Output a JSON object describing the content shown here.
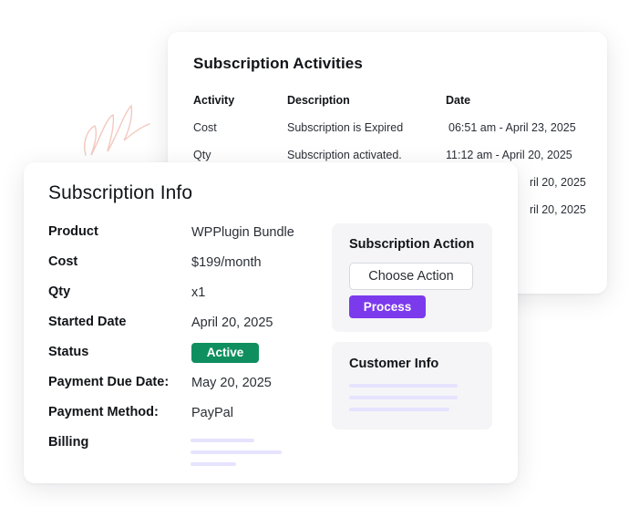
{
  "activities": {
    "title": "Subscription Activities",
    "columns": [
      "Activity",
      "Description",
      "Date"
    ],
    "rows": [
      {
        "activity": "Cost",
        "description": "Subscription is Expired",
        "date": "06:51 am - April 23, 2025"
      },
      {
        "activity": "Qty",
        "description": "Subscription activated.",
        "date": "11:12 am - April 20, 2025"
      },
      {
        "activity": "",
        "description": "",
        "date": "ril 20, 2025"
      },
      {
        "activity": "",
        "description": "",
        "date": "ril 20, 2025"
      }
    ]
  },
  "info": {
    "title": "Subscription Info",
    "fields": [
      {
        "label": "Product",
        "value": "WPPlugin Bundle"
      },
      {
        "label": "Cost",
        "value": "$199/month"
      },
      {
        "label": "Qty",
        "value": "x1"
      },
      {
        "label": "Started Date",
        "value": "April 20, 2025"
      },
      {
        "label": "Status",
        "value": "Active"
      },
      {
        "label": "Payment Due Date:",
        "value": "May 20, 2025"
      },
      {
        "label": "Payment Method:",
        "value": "PayPal"
      },
      {
        "label": "Billing",
        "value": ""
      }
    ]
  },
  "action_panel": {
    "title": "Subscription Action",
    "select_label": "Choose Action",
    "button_label": "Process"
  },
  "customer_panel": {
    "title": "Customer Info"
  },
  "colors": {
    "status_active": "#0f8f5f",
    "process_button": "#7c3aed",
    "placeholder_line": "#e6e3ff",
    "panel_bg": "#f5f5f7",
    "scribble": "#f3c9bf"
  }
}
